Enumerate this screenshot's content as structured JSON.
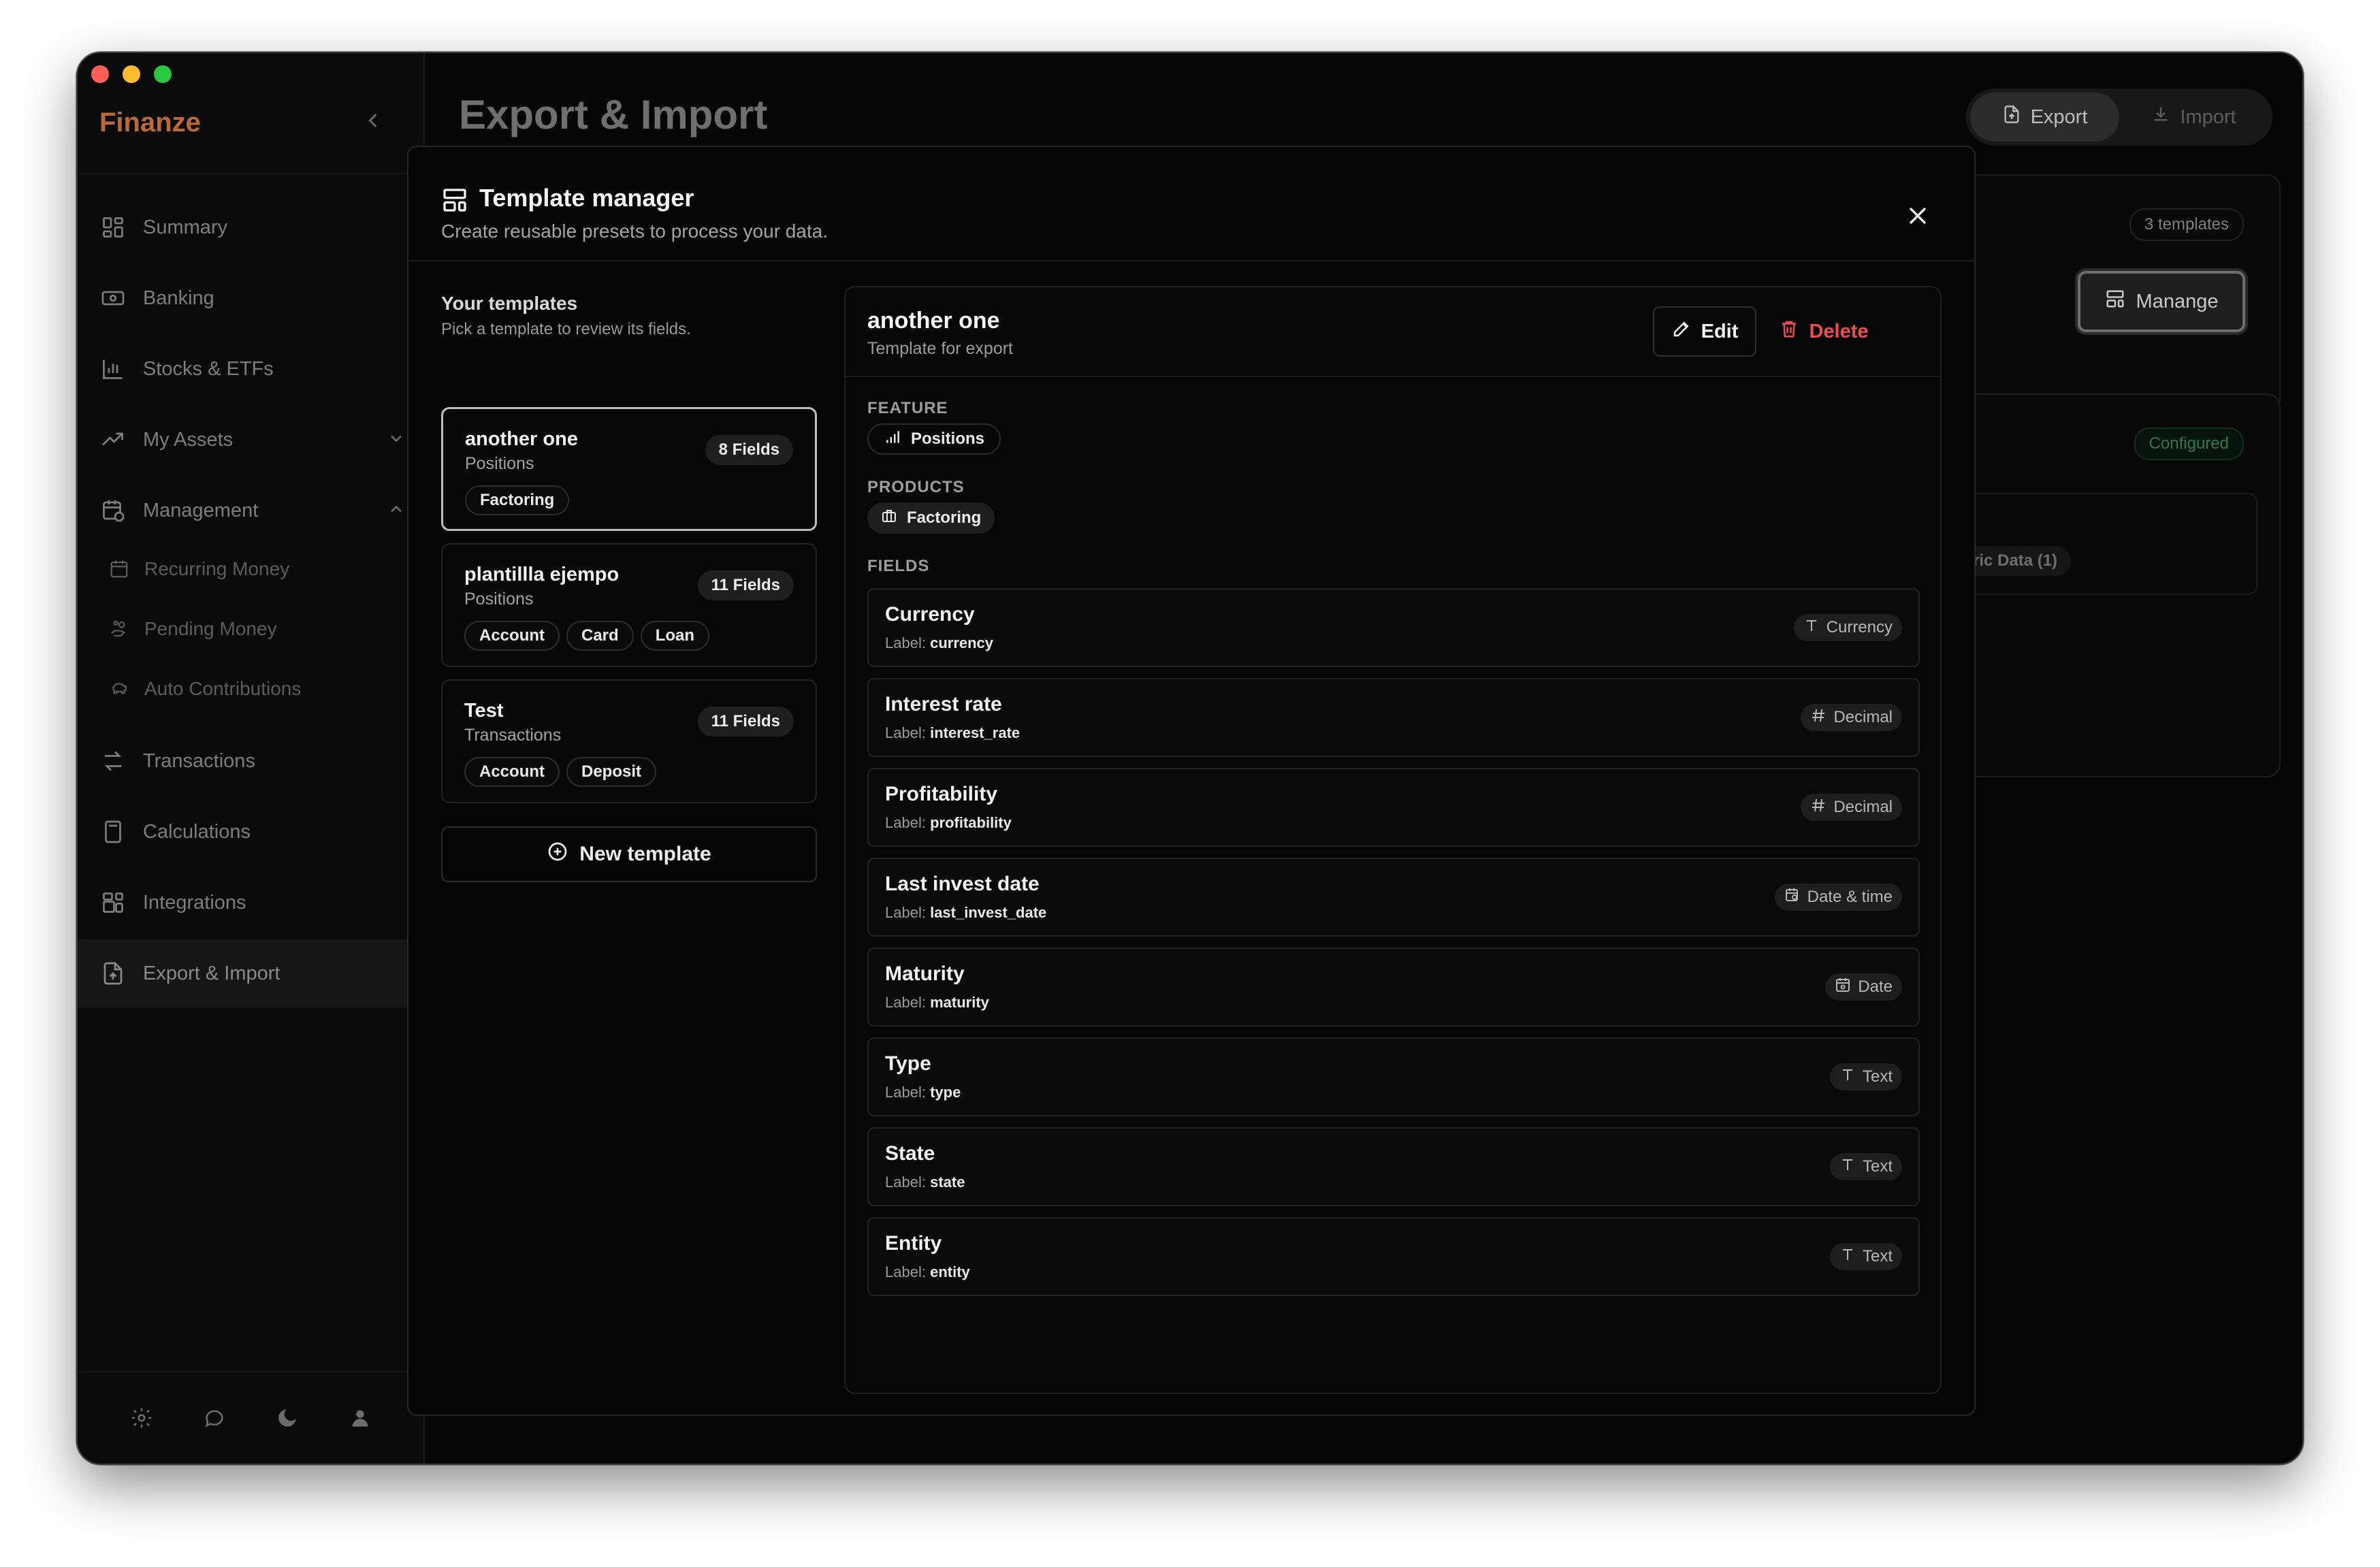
{
  "app": {
    "name": "Finanze"
  },
  "sidebar": {
    "items": [
      {
        "label": "Summary",
        "icon": "grid-icon"
      },
      {
        "label": "Banking",
        "icon": "banknote-icon"
      },
      {
        "label": "Stocks & ETFs",
        "icon": "bar-chart-icon"
      },
      {
        "label": "My Assets",
        "icon": "trending-up-icon"
      },
      {
        "label": "Management",
        "icon": "calendar-clock-icon"
      },
      {
        "label": "Recurring Money",
        "icon": "calendar-sync-icon"
      },
      {
        "label": "Pending Money",
        "icon": "hand-coins-icon"
      },
      {
        "label": "Auto Contributions",
        "icon": "piggy-bank-icon"
      },
      {
        "label": "Transactions",
        "icon": "arrows-left-right-icon"
      },
      {
        "label": "Calculations",
        "icon": "calculator-icon"
      },
      {
        "label": "Integrations",
        "icon": "blocks-icon"
      },
      {
        "label": "Export & Import",
        "icon": "file-export-icon"
      }
    ]
  },
  "page": {
    "title": "Export & Import"
  },
  "tabs": {
    "export": "Export",
    "import": "Import"
  },
  "background": {
    "templates_badge": "3 templates",
    "manage_label": "Manange",
    "configured_badge": "Configured",
    "data_pill": "ric Data (1)"
  },
  "modal": {
    "title": "Template manager",
    "subtitle": "Create reusable presets to process your data.",
    "list_title": "Your templates",
    "list_subtitle": "Pick a template to review its fields.",
    "count": "3",
    "templates": [
      {
        "name": "another one",
        "feature": "Positions",
        "fields": "8 Fields",
        "products": [
          "Factoring"
        ]
      },
      {
        "name": "plantillla ejempo",
        "feature": "Positions",
        "fields": "11 Fields",
        "products": [
          "Account",
          "Card",
          "Loan"
        ]
      },
      {
        "name": "Test",
        "feature": "Transactions",
        "fields": "11 Fields",
        "products": [
          "Account",
          "Deposit"
        ]
      }
    ],
    "new_template": "New template"
  },
  "detail": {
    "name": "another one",
    "subtitle": "Template for export",
    "edit": "Edit",
    "delete": "Delete",
    "feature_label": "FEATURE",
    "feature": "Positions",
    "products_label": "PRODUCTS",
    "product": "Factoring",
    "fields_label": "FIELDS",
    "label_prefix": "Label:",
    "fields": [
      {
        "name": "Currency",
        "label": "currency",
        "type": "Currency",
        "type_icon": "type-T-icon"
      },
      {
        "name": "Interest rate",
        "label": "interest_rate",
        "type": "Decimal",
        "type_icon": "hash-icon"
      },
      {
        "name": "Profitability",
        "label": "profitability",
        "type": "Decimal",
        "type_icon": "hash-icon"
      },
      {
        "name": "Last invest date",
        "label": "last_invest_date",
        "type": "Date & time",
        "type_icon": "calendar-clock-icon"
      },
      {
        "name": "Maturity",
        "label": "maturity",
        "type": "Date",
        "type_icon": "calendar-icon"
      },
      {
        "name": "Type",
        "label": "type",
        "type": "Text",
        "type_icon": "type-T-icon"
      },
      {
        "name": "State",
        "label": "state",
        "type": "Text",
        "type_icon": "type-T-icon"
      },
      {
        "name": "Entity",
        "label": "entity",
        "type": "Text",
        "type_icon": "type-T-icon"
      }
    ]
  },
  "colors": {
    "brand": "#ba6a38",
    "danger": "#ec4e4e",
    "configured": "#2f7a4a"
  }
}
